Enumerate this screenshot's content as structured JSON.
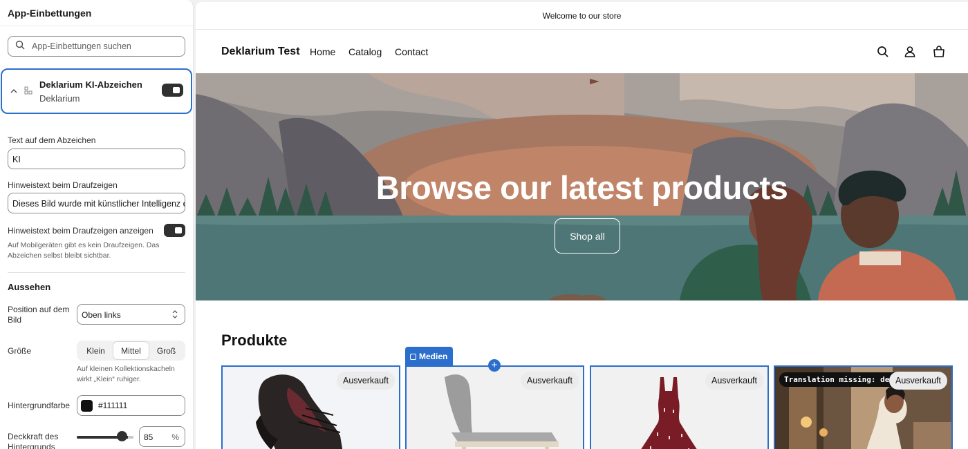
{
  "sidebar": {
    "title": "App-Einbettungen",
    "search_placeholder": "App-Einbettungen suchen",
    "block": {
      "name": "Deklarium KI-Abzeichen",
      "app": "Deklarium",
      "enabled": true
    },
    "badge_text": {
      "label": "Text auf dem Abzeichen",
      "value": "KI"
    },
    "hover_text": {
      "label": "Hinweistext beim Draufzeigen",
      "value": "Dieses Bild wurde mit künstlicher Intelligenz e"
    },
    "show_hover": {
      "label": "Hinweistext beim Draufzeigen anzeigen",
      "enabled": true,
      "help": "Auf Mobilgeräten gibt es kein Draufzeigen. Das Abzeichen selbst bleibt sichtbar."
    },
    "section_appearance": "Aussehen",
    "position": {
      "label": "Position auf dem Bild",
      "value": "Oben links"
    },
    "size": {
      "label": "Größe",
      "options": [
        "Klein",
        "Mittel",
        "Groß"
      ],
      "selected": "Mittel",
      "help": "Auf kleinen Kollektionskacheln wirkt „Klein“ ruhiger."
    },
    "bg_color": {
      "label": "Hintergrundfarbe",
      "value": "#111111"
    },
    "bg_opacity": {
      "label": "Deckkraft des Hintergrunds",
      "value": "85",
      "unit": "%"
    }
  },
  "preview": {
    "announcement": "Welcome to our store",
    "brand": "Deklarium Test",
    "nav": [
      "Home",
      "Catalog",
      "Contact"
    ],
    "hero": {
      "title": "Browse our latest products",
      "button": "Shop all"
    },
    "products_title": "Produkte",
    "medien_label": "Medien",
    "plus_label": "+",
    "cards": [
      {
        "badge": "Ausverkauft"
      },
      {
        "badge": "Ausverkauft"
      },
      {
        "badge": "Ausverkauft"
      },
      {
        "badge": "Ausverkauft",
        "overlay": "Translation missing: de.KI"
      }
    ],
    "colors": {
      "accent": "#2c6ecb",
      "hero_sky": "#9a9a9a",
      "hero_lake": "#4f7676"
    }
  }
}
